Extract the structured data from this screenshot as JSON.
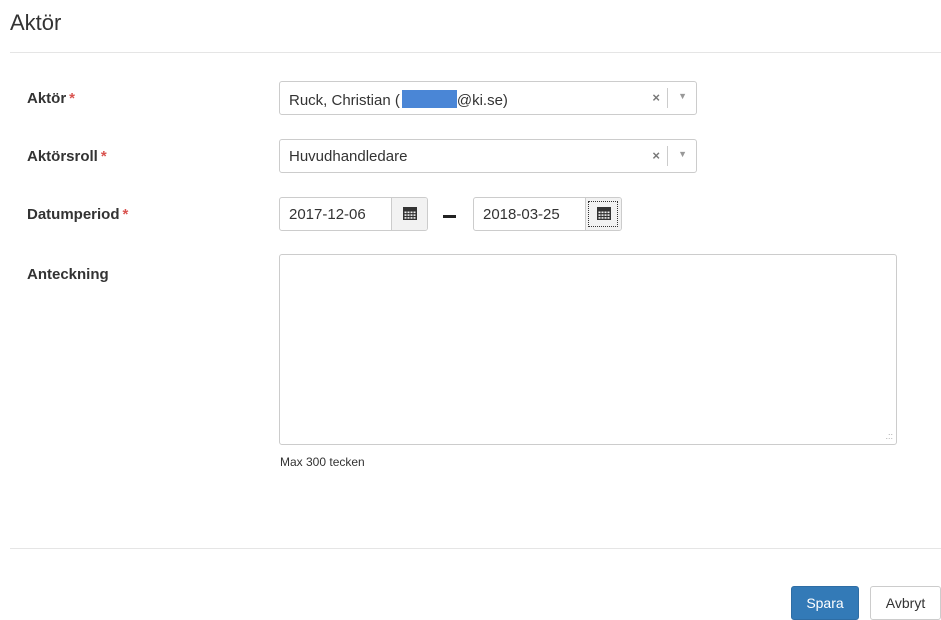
{
  "dialog": {
    "title": "Aktör"
  },
  "required_marker": "*",
  "fields": {
    "actor": {
      "label": "Aktör",
      "value_prefix": "Ruck, Christian (",
      "value_suffix": "@ki.se)",
      "clear_glyph": "×",
      "dropdown_glyph": "▼"
    },
    "role": {
      "label": "Aktörsroll",
      "value": "Huvudhandledare",
      "clear_glyph": "×",
      "dropdown_glyph": "▼"
    },
    "period": {
      "label": "Datumperiod",
      "start": "2017-12-06",
      "end": "2018-03-25"
    },
    "note": {
      "label": "Anteckning",
      "value": "",
      "hint": "Max 300 tecken"
    }
  },
  "buttons": {
    "save": "Spara",
    "cancel": "Avbryt"
  },
  "colors": {
    "primary": "#337ab7",
    "required": "#d9534f",
    "redaction": "#4a86d6"
  }
}
